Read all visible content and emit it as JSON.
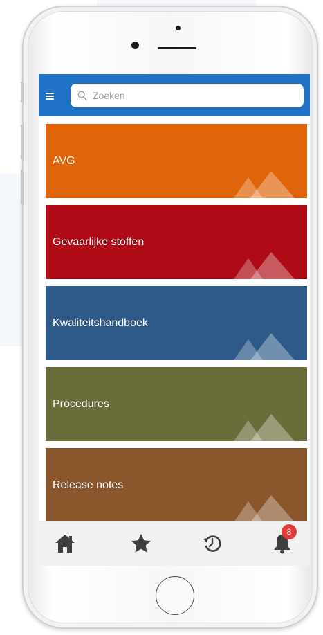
{
  "search": {
    "placeholder": "Zoeken"
  },
  "categories": [
    {
      "label": "AVG",
      "color": "#e0640a"
    },
    {
      "label": "Gevaarlijke stoffen",
      "color": "#ae0b16"
    },
    {
      "label": "Kwaliteitshandboek",
      "color": "#2e5a8a"
    },
    {
      "label": "Procedures",
      "color": "#6a6d3a"
    },
    {
      "label": "Release notes",
      "color": "#8a562c"
    }
  ],
  "tabbar": {
    "items": [
      {
        "icon": "home-icon"
      },
      {
        "icon": "star-icon"
      },
      {
        "icon": "history-icon"
      },
      {
        "icon": "bell-icon",
        "badge": "8"
      }
    ]
  },
  "colors": {
    "topbar": "#1f72c6",
    "badge": "#e53935",
    "tab_icon": "#3e3e3e"
  }
}
